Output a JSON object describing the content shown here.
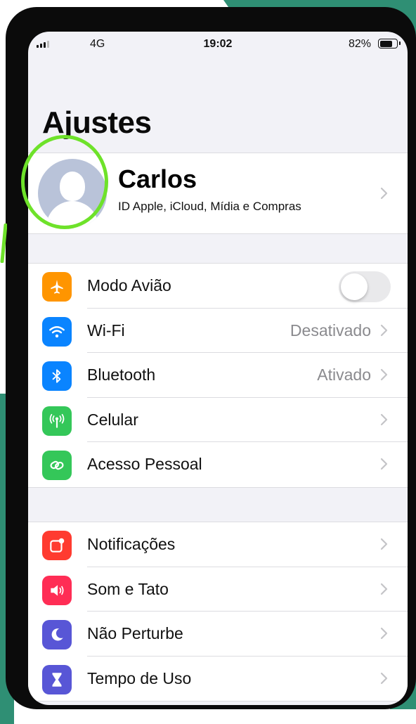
{
  "status_bar": {
    "network": "4G",
    "time": "19:02",
    "battery": "82%",
    "battery_level": 0.82
  },
  "title": "Ajustes",
  "profile": {
    "name": "Carlos",
    "subtitle": "ID Apple, iCloud, Mídia e Compras"
  },
  "group1": [
    {
      "label": "Modo Avião",
      "icon": "airplane-icon",
      "color": "#ff9500",
      "type": "toggle",
      "toggle_on": false
    },
    {
      "label": "Wi-Fi",
      "icon": "wifi-icon",
      "color": "#0a84ff",
      "value": "Desativado"
    },
    {
      "label": "Bluetooth",
      "icon": "bluetooth-icon",
      "color": "#0a84ff",
      "value": "Ativado"
    },
    {
      "label": "Celular",
      "icon": "antenna-icon",
      "color": "#34c759"
    },
    {
      "label": "Acesso Pessoal",
      "icon": "hotspot-icon",
      "color": "#34c759"
    }
  ],
  "group2": [
    {
      "label": "Notificações",
      "icon": "notification-icon",
      "color": "#ff3b30"
    },
    {
      "label": "Som e Tato",
      "icon": "speaker-icon",
      "color": "#ff2d55"
    },
    {
      "label": "Não Perturbe",
      "icon": "moon-icon",
      "color": "#5856d6"
    },
    {
      "label": "Tempo de Uso",
      "icon": "hourglass-icon",
      "color": "#5856d6"
    }
  ],
  "colors": {
    "highlight": "#6ee22a",
    "background_accent": "#2f8f74",
    "chevron": "#c4c4c7"
  }
}
